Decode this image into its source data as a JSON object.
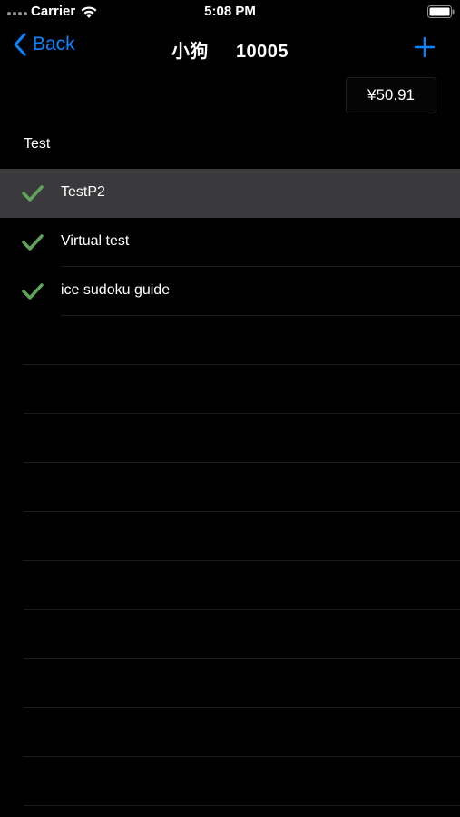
{
  "status_bar": {
    "carrier": "Carrier",
    "time": "5:08 PM"
  },
  "nav": {
    "back_label": "Back",
    "title_name": "小狗",
    "title_id": "10005",
    "accent_color": "#0a84ff"
  },
  "balance": "¥50.91",
  "section": {
    "header": "Test"
  },
  "items": [
    {
      "label": "TestP2",
      "checked": true,
      "selected": true
    },
    {
      "label": "Virtual test",
      "checked": true,
      "selected": false
    },
    {
      "label": "ice sudoku guide",
      "checked": true,
      "selected": false
    }
  ],
  "icons": {
    "check_color": "#5fa55a"
  }
}
